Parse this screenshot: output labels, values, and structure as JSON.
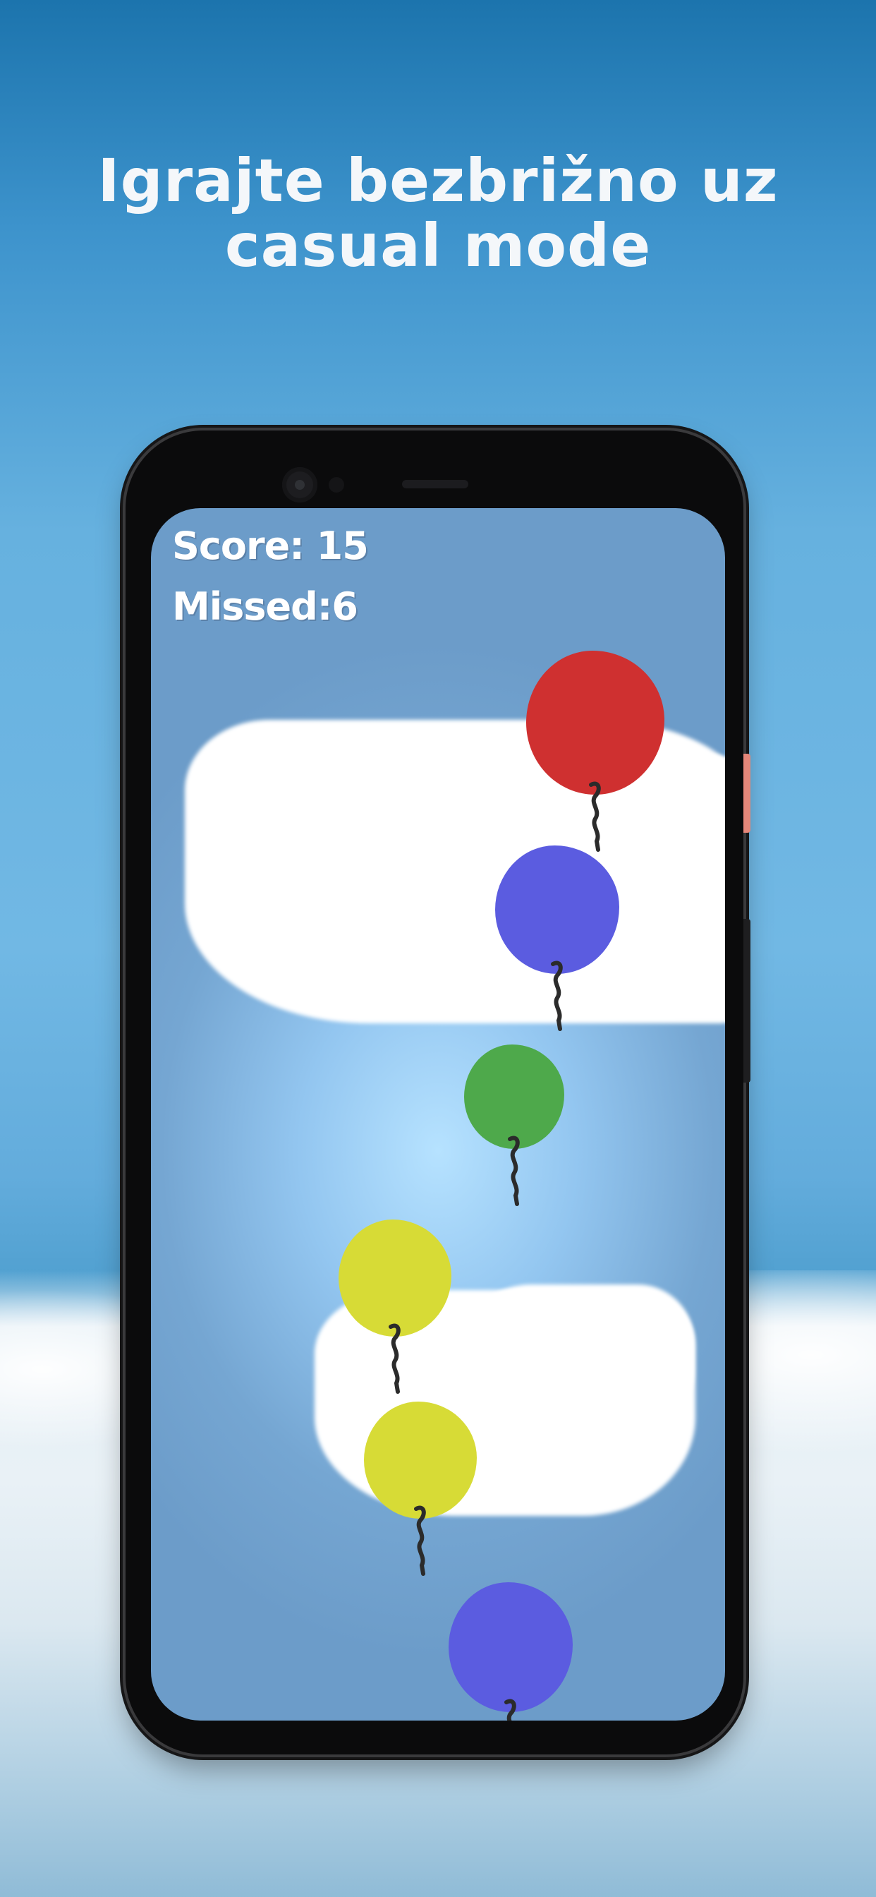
{
  "headline": {
    "line1": "Igrajte bezbrižno uz",
    "line2": "casual mode"
  },
  "game": {
    "score_label": "Score: 15",
    "missed_label": "Missed:6",
    "score": 15,
    "missed": 6
  },
  "balloons": [
    {
      "name": "balloon-red",
      "color": "#cf3030"
    },
    {
      "name": "balloon-blue",
      "color": "#5b5ce0"
    },
    {
      "name": "balloon-green",
      "color": "#4ea94b"
    },
    {
      "name": "balloon-yellow",
      "color": "#d7db36"
    },
    {
      "name": "balloon-yellow",
      "color": "#d7db36"
    },
    {
      "name": "balloon-blue",
      "color": "#5b5ce0"
    }
  ],
  "colors": {
    "sky_top": "#1c74ad",
    "sky_mid": "#71b8e4",
    "screen_center": "#b6e2ff",
    "screen_edge": "#6c9cc9",
    "phone_body": "#0b0b0c",
    "power_button": "#e5877a",
    "string": "#2b2b2b"
  }
}
